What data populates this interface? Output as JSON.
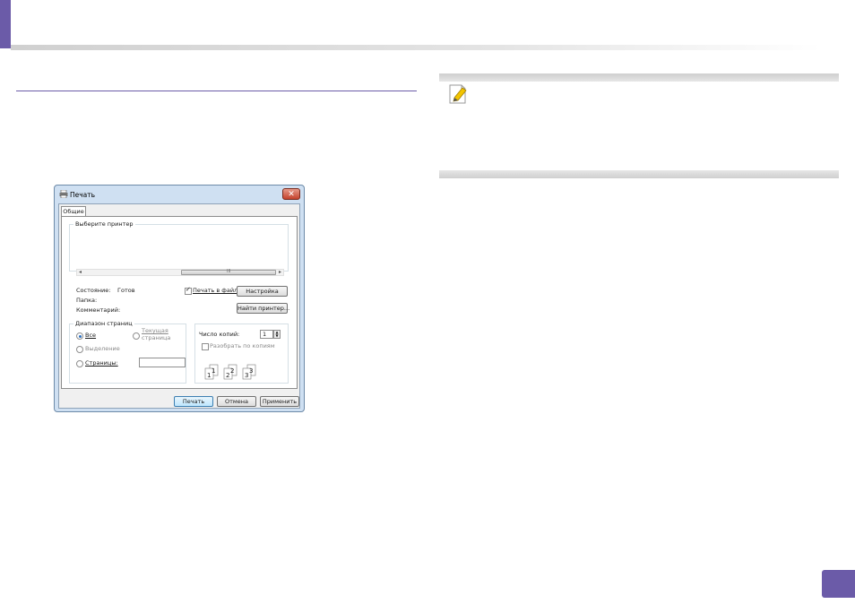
{
  "colors": {
    "accent": "#6b5ba8",
    "rule_gray": "#d0d0d0",
    "note_icon": "#f2c400"
  },
  "icons": {
    "note": "note-pencil-icon",
    "dialog": "printer-icon",
    "close": "close-icon"
  },
  "dialog": {
    "title": "Печать",
    "close_glyph": "✕",
    "tab": "Общие",
    "printer_group_label": "Выберите принтер",
    "scroll_left": "◂",
    "scroll_right": "▸",
    "scroll_grip": "III",
    "status_label": "Состояние:",
    "status_value": "Готов",
    "folder_label": "Папка:",
    "comment_label": "Комментарий:",
    "print_to_file": "Печать в файл",
    "print_to_file_checked": true,
    "settings_button": "Настройка",
    "find_printer_button": "Найти принтер...",
    "range_group_label": "Диапазон страниц",
    "range_all": "Все",
    "range_current_line1": "Текущая",
    "range_current_line2": "страница",
    "range_selection": "Выделение",
    "range_pages": "Страницы:",
    "pages_value": "",
    "copies_label": "Число копий:",
    "copies_value": "1",
    "collate_label": "Разобрать по копиям",
    "collate_checked": false,
    "collate_digits": [
      "1",
      "1",
      "2",
      "2",
      "3",
      "3"
    ],
    "print_button": "Печать",
    "cancel_button": "Отмена",
    "apply_button": "Применить"
  }
}
